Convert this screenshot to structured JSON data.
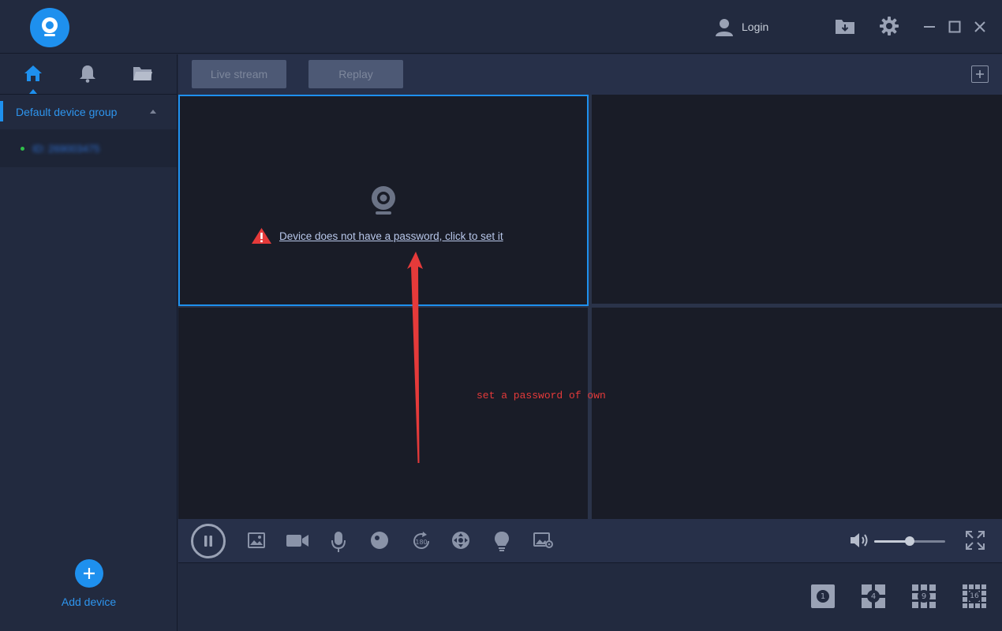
{
  "header": {
    "login_label": "Login",
    "icons": [
      "logo-icon",
      "user-icon",
      "download-folder-icon",
      "gear-icon",
      "minimize-icon",
      "maximize-icon",
      "close-icon"
    ]
  },
  "sidebar": {
    "tabs": [
      "home-icon",
      "bell-icon",
      "folder-icon"
    ],
    "group_label": "Default device group",
    "device_label": "ID: 269003475",
    "add_device_label": "Add device"
  },
  "toolbar": {
    "live_stream_label": "Live stream",
    "replay_label": "Replay"
  },
  "viewer": {
    "no_password_message": "Device does not have a password, click to set it",
    "annotation": "set a password of own"
  },
  "controls": {
    "icons": [
      "pause-icon",
      "snapshot-icon",
      "record-icon",
      "microphone-icon",
      "ptz-icon",
      "rotate-180-icon",
      "direction-icon",
      "light-icon",
      "picture-settings-icon",
      "volume-icon",
      "fullscreen-icon"
    ],
    "volume_level": 0.5
  },
  "layouts": [
    "1",
    "4",
    "9",
    "16"
  ],
  "colors": {
    "accent": "#1e90ee",
    "warning": "#e53a3a"
  }
}
